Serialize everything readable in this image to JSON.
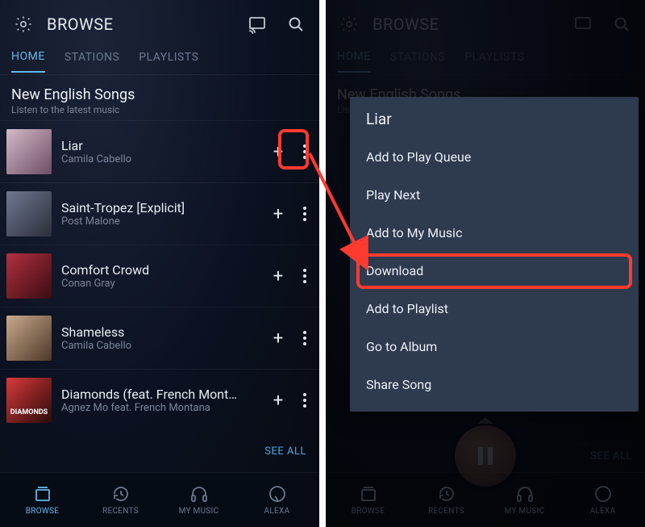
{
  "colors": {
    "accent": "#64b8e8",
    "annotation": "#ff3b30"
  },
  "left": {
    "appbar": {
      "title": "BROWSE"
    },
    "tabs": [
      "HOME",
      "STATIONS",
      "PLAYLISTS"
    ],
    "active_tab_index": 0,
    "section": {
      "title": "New English Songs",
      "subtitle": "Listen to the latest music"
    },
    "songs": [
      {
        "title": "Liar",
        "artist": "Camila Cabello"
      },
      {
        "title": "Saint-Tropez [Explicit]",
        "artist": "Post Malone"
      },
      {
        "title": "Comfort Crowd",
        "artist": "Conan Gray"
      },
      {
        "title": "Shameless",
        "artist": "Camila Cabello"
      },
      {
        "title": "Diamonds (feat. French Mont…",
        "artist": "Agnez Mo feat. French Montana"
      }
    ],
    "see_all": "SEE ALL",
    "bottomnav": [
      {
        "label": "BROWSE",
        "active": true
      },
      {
        "label": "RECENTS",
        "active": false
      },
      {
        "label": "MY MUSIC",
        "active": false
      },
      {
        "label": "ALEXA",
        "active": false
      }
    ]
  },
  "right": {
    "appbar": {
      "title": "BROWSE"
    },
    "tabs": [
      "HOME",
      "STATIONS",
      "PLAYLISTS"
    ],
    "active_tab_index": 0,
    "section": {
      "title": "New English Songs",
      "subtitle": "Listen to the latest music"
    },
    "see_all": "SEE ALL",
    "sheet": {
      "title": "Liar",
      "items": [
        "Add to Play Queue",
        "Play Next",
        "Add to My Music",
        "Download",
        "Add to Playlist",
        "Go to Album",
        "Share Song"
      ],
      "highlight_index": 3
    },
    "bottomnav": [
      {
        "label": "BROWSE",
        "active": false
      },
      {
        "label": "RECENTS",
        "active": false
      },
      {
        "label": "MY MUSIC",
        "active": false
      },
      {
        "label": "ALEXA",
        "active": false
      }
    ]
  },
  "icons": {
    "gear": "gear-icon",
    "cast": "cast-icon",
    "search": "search-icon",
    "plus": "plus-icon",
    "more": "more-vert-icon",
    "browse": "browse-icon",
    "recents": "history-icon",
    "music": "headphones-icon",
    "alexa": "alexa-ring-icon",
    "pause": "pause-icon"
  }
}
